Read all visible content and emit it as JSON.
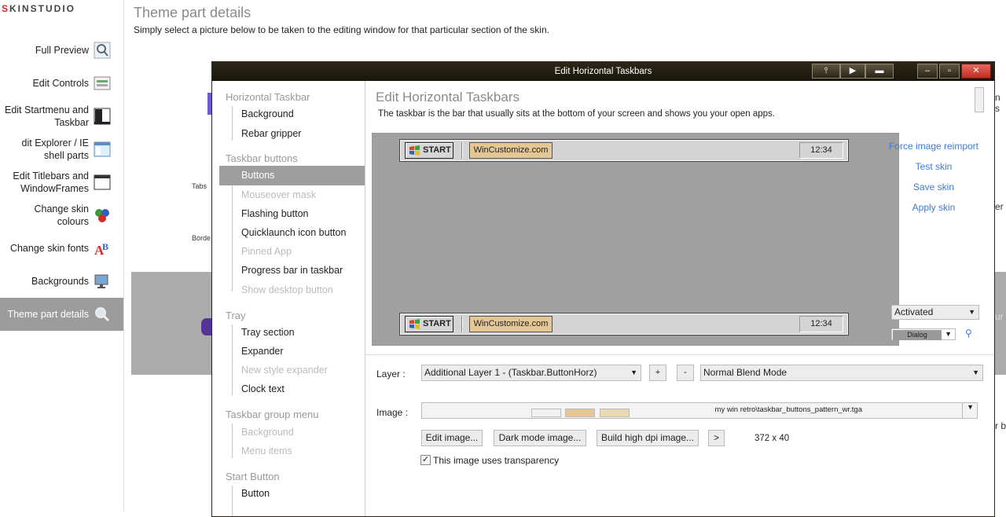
{
  "logo": {
    "text": "SKINSTUDIO"
  },
  "sidebar": {
    "items": [
      {
        "label": "Full Preview",
        "icon": "magnifier-icon"
      },
      {
        "label": "Edit Controls",
        "icon": "controls-icon"
      },
      {
        "label": "Edit Startmenu and Taskbar",
        "icon": "startmenu-icon"
      },
      {
        "label": "dit Explorer / IE shell parts",
        "icon": "explorer-icon"
      },
      {
        "label": "Edit Titlebars and WindowFrames",
        "icon": "window-icon"
      },
      {
        "label": "Change skin colours",
        "icon": "colours-icon"
      },
      {
        "label": "Change skin fonts",
        "icon": "fonts-icon"
      },
      {
        "label": "Backgrounds",
        "icon": "backgrounds-icon"
      },
      {
        "label": "Theme part details",
        "icon": "magnifier-icon"
      }
    ],
    "active_index": 8
  },
  "main": {
    "title": "Theme part details",
    "description": "Simply select a picture below to be taken to the editing window for that particular section of the skin.",
    "bg_labels": {
      "tabs": "Tabs",
      "borders": "Borde"
    },
    "edge_scraps": [
      "n s",
      "er",
      "ur",
      "r b"
    ]
  },
  "dialog": {
    "title": "Edit Horizontal Taskbars",
    "nav": [
      {
        "type": "group",
        "label": "Horizontal Taskbar"
      },
      {
        "type": "item",
        "label": "Background",
        "state": "normal"
      },
      {
        "type": "item",
        "label": "Rebar gripper",
        "state": "normal"
      },
      {
        "type": "group",
        "label": "Taskbar buttons"
      },
      {
        "type": "item",
        "label": "Buttons",
        "state": "selected"
      },
      {
        "type": "item",
        "label": "Mouseover mask",
        "state": "disabled"
      },
      {
        "type": "item",
        "label": "Flashing button",
        "state": "normal"
      },
      {
        "type": "item",
        "label": "Quicklaunch icon button",
        "state": "normal"
      },
      {
        "type": "item",
        "label": "Pinned App",
        "state": "disabled"
      },
      {
        "type": "item",
        "label": "Progress bar in taskbar",
        "state": "normal"
      },
      {
        "type": "item",
        "label": "Show desktop button",
        "state": "disabled"
      },
      {
        "type": "group",
        "label": "Tray"
      },
      {
        "type": "item",
        "label": "Tray section",
        "state": "normal"
      },
      {
        "type": "item",
        "label": "Expander",
        "state": "normal"
      },
      {
        "type": "item",
        "label": "New style expander",
        "state": "disabled"
      },
      {
        "type": "item",
        "label": "Clock text",
        "state": "normal"
      },
      {
        "type": "group",
        "label": "Taskbar group menu"
      },
      {
        "type": "item",
        "label": "Background",
        "state": "disabled"
      },
      {
        "type": "item",
        "label": "Menu items",
        "state": "disabled"
      },
      {
        "type": "group",
        "label": "Start Button"
      },
      {
        "type": "item",
        "label": "Button",
        "state": "normal"
      }
    ],
    "content_title": "Edit Horizontal Taskbars",
    "content_desc": "The taskbar is the bar that usually sits at the bottom of your screen and shows you your open apps.",
    "preview": {
      "start_label": "START",
      "task_label": "WinCustomize.com",
      "clock": "12:34"
    },
    "links": [
      "Force image reimport",
      "Test skin",
      "Save skin",
      "Apply skin"
    ],
    "state_select": "Activated",
    "part_select": "Dialog",
    "layer_label": "Layer :",
    "layer_value": "Additional Layer 1 - (Taskbar.ButtonHorz)",
    "plus": "+",
    "minus": "-",
    "blend_value": "Normal Blend Mode",
    "image_label": "Image :",
    "image_path": "my win retro\\taskbar_buttons_pattern_wr.tga",
    "buttons": {
      "edit": "Edit image...",
      "dark": "Dark mode image...",
      "hidpi": "Build high dpi image...",
      "more": ">"
    },
    "dims": "372 x 40",
    "transparency_label": "This image uses transparency",
    "transparency_checked": true,
    "colors": {
      "titlebar": "#2d2718",
      "link": "#3a7ad6",
      "task_button": "#e5c796",
      "selected": "#9e9e9e"
    }
  }
}
